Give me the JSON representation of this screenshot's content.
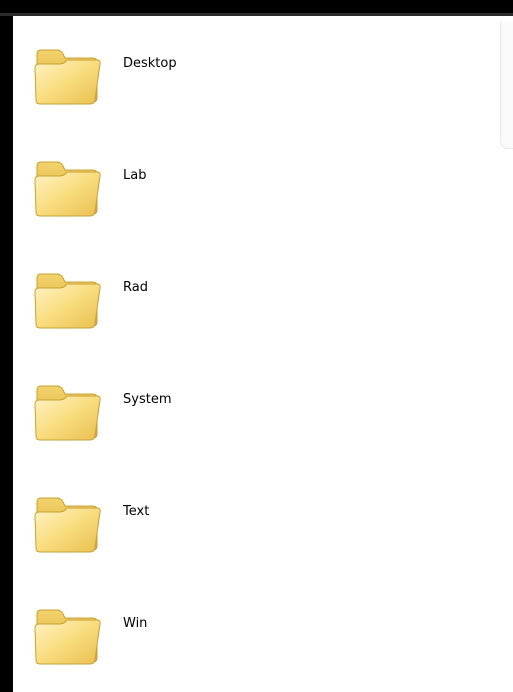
{
  "explorer": {
    "folders": [
      {
        "label": "Desktop",
        "icon": "folder-icon"
      },
      {
        "label": "Lab",
        "icon": "folder-icon"
      },
      {
        "label": "Rad",
        "icon": "folder-icon"
      },
      {
        "label": "System",
        "icon": "folder-icon"
      },
      {
        "label": "Text",
        "icon": "folder-icon"
      },
      {
        "label": "Win",
        "icon": "folder-icon"
      }
    ]
  },
  "colors": {
    "background": "#ffffff",
    "frame": "#000000",
    "folder_front": "#f6d978",
    "folder_back": "#e8bd45",
    "folder_outline": "#c9a032"
  }
}
